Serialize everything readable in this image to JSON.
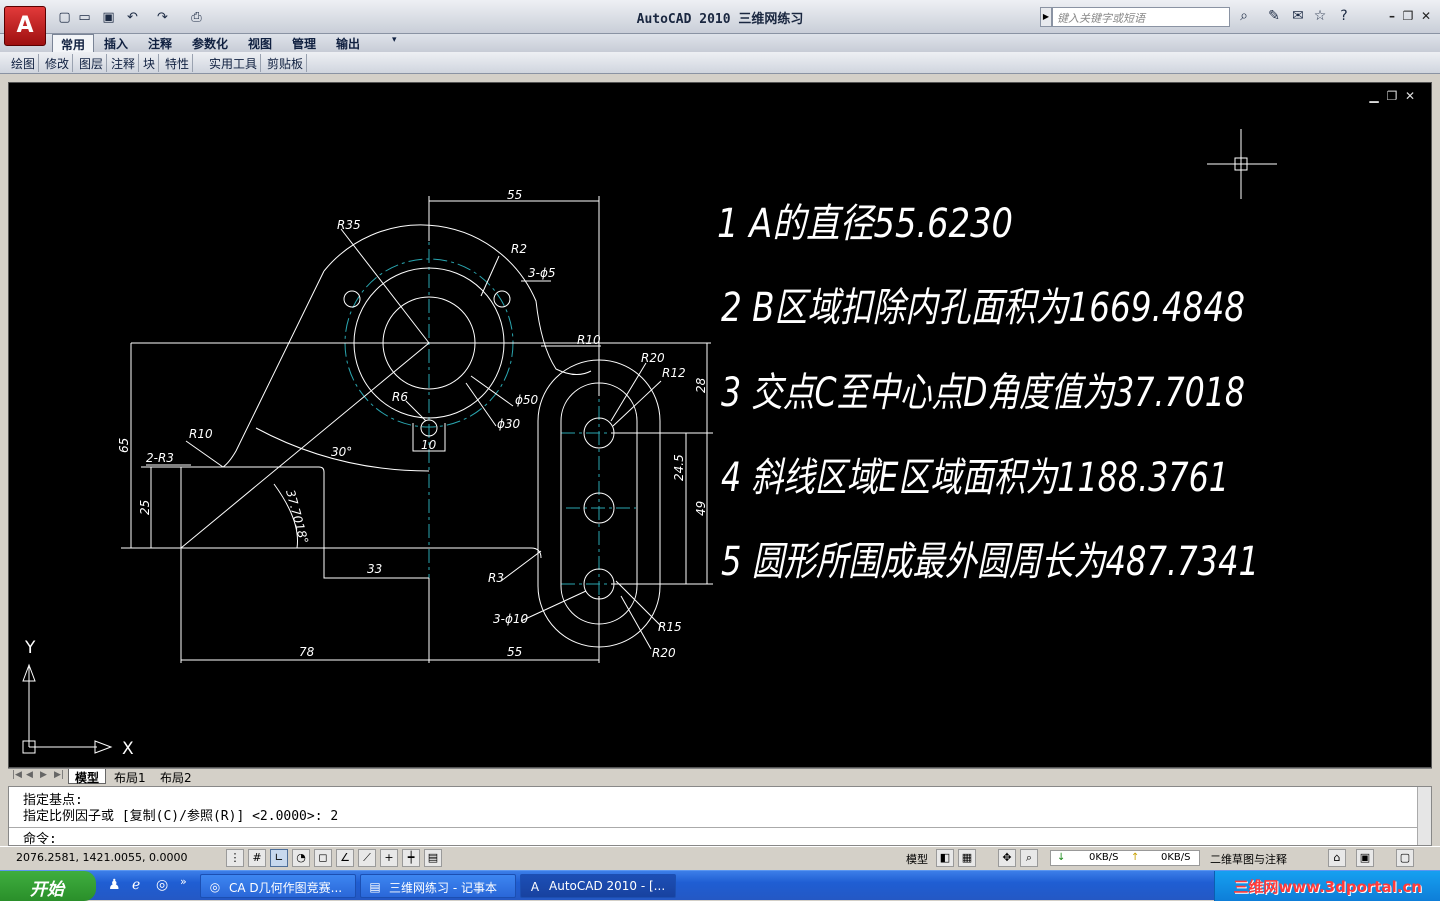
{
  "window": {
    "title": "AutoCAD 2010   三维网练习",
    "search_placeholder": "键入关键字或短语"
  },
  "quick_access": [
    "new-icon",
    "open-icon",
    "save-icon",
    "undo-icon",
    "redo-icon",
    "plot-icon"
  ],
  "ribbon": {
    "tabs": [
      "常用",
      "插入",
      "注释",
      "参数化",
      "视图",
      "管理",
      "输出"
    ],
    "active_tab": "常用"
  },
  "panels": [
    "绘图",
    "修改",
    "图层",
    "注释",
    "块",
    "特性",
    "实用工具",
    "剪贴板"
  ],
  "drawing": {
    "dims": {
      "d55_top": "55",
      "r35": "R35",
      "r2": "R2",
      "hole3": "3-ϕ5",
      "r10_right": "R10",
      "r20_top": "R20",
      "r12": "R12",
      "d28": "28",
      "phi50": "ϕ50",
      "r6": "R6",
      "phi30": "ϕ30",
      "d10": "10",
      "r10_left": "R10",
      "d65": "65",
      "a30": "30°",
      "r3_left": "2-R3",
      "d25": "25",
      "angle": "37.7018°",
      "d24_5": "24.5",
      "d49": "49",
      "d33": "33",
      "r3": "R3",
      "hole10": "3-ϕ10",
      "r15": "R15",
      "r20_bot": "R20",
      "d78": "78",
      "d55_bot": "55"
    },
    "answers": [
      "1 A的直径55.6230",
      "2 B区域扣除内孔面积为1669.4848",
      "3 交点C至中心点D角度值为37.7018",
      "4 斜线区域E区域面积为1188.3761",
      "5 圆形所围成最外圆周长为487.7341"
    ],
    "ucs": {
      "x": "X",
      "y": "Y"
    }
  },
  "layout_tabs": [
    "模型",
    "布局1",
    "布局2"
  ],
  "command": {
    "history": [
      "指定基点:",
      "指定比例因子或 [复制(C)/参照(R)] <2.0000>:  2"
    ],
    "prompt": "命令:"
  },
  "status": {
    "coords": "2076.2581, 1421.0055, 0.0000",
    "model_label": "模型",
    "workspace": "二维草图与注释",
    "down_speed": "0KB/S",
    "up_speed": "0KB/S"
  },
  "taskbar": {
    "start": "开始",
    "items": [
      "CA D几何作图竞赛...",
      "三维网练习 - 记事本",
      "AutoCAD 2010 - [..."
    ],
    "watermark": "三维网www.3dportal.cn"
  },
  "colors": {
    "drawing_bg": "#000000",
    "line": "#ffffff",
    "center": "#2aa6b0",
    "titlebar": "#c9ced8",
    "taskbar": "#2458c4"
  }
}
